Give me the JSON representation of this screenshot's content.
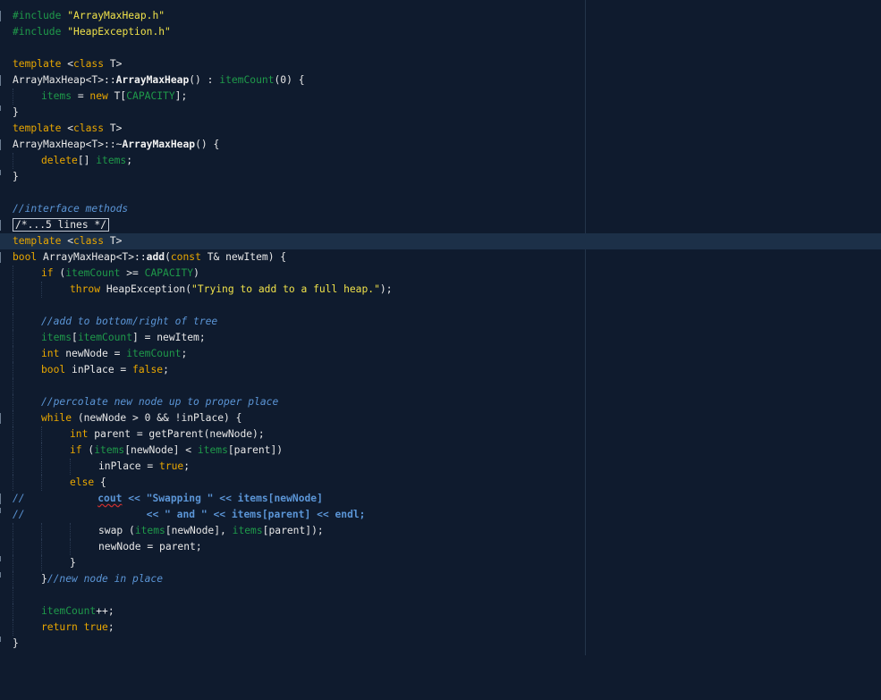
{
  "editor": {
    "lines": {
      "l1": {
        "pp": "#include",
        "str": "\"ArrayMaxHeap.h\""
      },
      "l2": {
        "pp": "#include",
        "str": "\"HeapException.h\""
      },
      "l4": {
        "kw1": "template",
        "t": " <",
        "kw2": "class",
        "t2": " T>"
      },
      "l5": {
        "a": "ArrayMaxHeap<T>::",
        "fn": "ArrayMaxHeap",
        "b": "() : ",
        "fld": "itemCount",
        "c": "(0) {"
      },
      "l6": {
        "fld1": "items",
        "a": " = ",
        "kw": "new",
        "b": " T[",
        "fld2": "CAPACITY",
        "c": "];"
      },
      "l7": {
        "t": "}"
      },
      "l8": {
        "kw1": "template",
        "t": " <",
        "kw2": "class",
        "t2": " T>"
      },
      "l9": {
        "a": "ArrayMaxHeap<T>::~",
        "fn": "ArrayMaxHeap",
        "b": "() {"
      },
      "l10": {
        "kw": "delete",
        "a": "[] ",
        "fld": "items",
        "b": ";"
      },
      "l11": {
        "t": "}"
      },
      "l13": {
        "cmt": "//interface methods"
      },
      "l14": {
        "folded": "/*...5 lines */"
      },
      "l15": {
        "kw1": "template",
        "t": " <",
        "kw2": "class",
        "t2": " T>"
      },
      "l16": {
        "kw1": "bool",
        "a": " ArrayMaxHeap<T>::",
        "fn": "add",
        "b": "(",
        "kw2": "const",
        "c": " T& newItem) {"
      },
      "l17": {
        "kw": "if",
        "a": " (",
        "fld1": "itemCount",
        "b": " >= ",
        "fld2": "CAPACITY",
        "c": ")"
      },
      "l18": {
        "kw": "throw",
        "a": " HeapException(",
        "str": "\"Trying to add to a full heap.\"",
        "b": ");"
      },
      "l20": {
        "cmt": "//add to bottom/right of tree"
      },
      "l21": {
        "fld1": "items",
        "a": "[",
        "fld2": "itemCount",
        "b": "] = newItem;"
      },
      "l22": {
        "kw": "int",
        "a": " newNode = ",
        "fld": "itemCount",
        "b": ";"
      },
      "l23": {
        "kw1": "bool",
        "a": " inPlace = ",
        "kw2": "false",
        "b": ";"
      },
      "l25": {
        "cmt": "//percolate new node up to proper place"
      },
      "l26": {
        "kw": "while",
        "a": " (newNode > 0 && !inPlace) {"
      },
      "l27": {
        "kw": "int",
        "a": " parent = getParent(newNode);"
      },
      "l28": {
        "kw": "if",
        "a": " (",
        "fld1": "items",
        "b": "[newNode] < ",
        "fld2": "items",
        "c": "[parent])"
      },
      "l29": {
        "a": "inPlace = ",
        "kw": "true",
        "b": ";"
      },
      "l30": {
        "kw": "else",
        "a": " {"
      },
      "l31": {
        "c1": "//",
        "sp": "            ",
        "err": "cout",
        "c2": " << \"Swapping \" << items[newNode]"
      },
      "l32": {
        "c1": "//",
        "sp": "                    ",
        "c2": "<< \" and \" << items[parent] << endl;"
      },
      "l33": {
        "a": "swap (",
        "fld1": "items",
        "b": "[newNode], ",
        "fld2": "items",
        "c": "[parent]);"
      },
      "l34": {
        "a": "newNode = parent;"
      },
      "l35": {
        "t": "}"
      },
      "l36": {
        "a": "}",
        "cmt": "//new node in place"
      },
      "l38": {
        "fld": "itemCount",
        "a": "++;"
      },
      "l39": {
        "kw1": "return",
        "a": " ",
        "kw2": "true",
        "b": ";"
      },
      "l40": {
        "t": "}"
      }
    }
  }
}
